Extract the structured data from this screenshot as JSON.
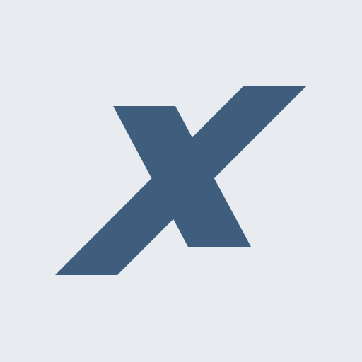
{
  "icon": {
    "name": "x-logo-icon",
    "background_color": "#e8ebef",
    "mark_color": "#3f5d7d"
  }
}
